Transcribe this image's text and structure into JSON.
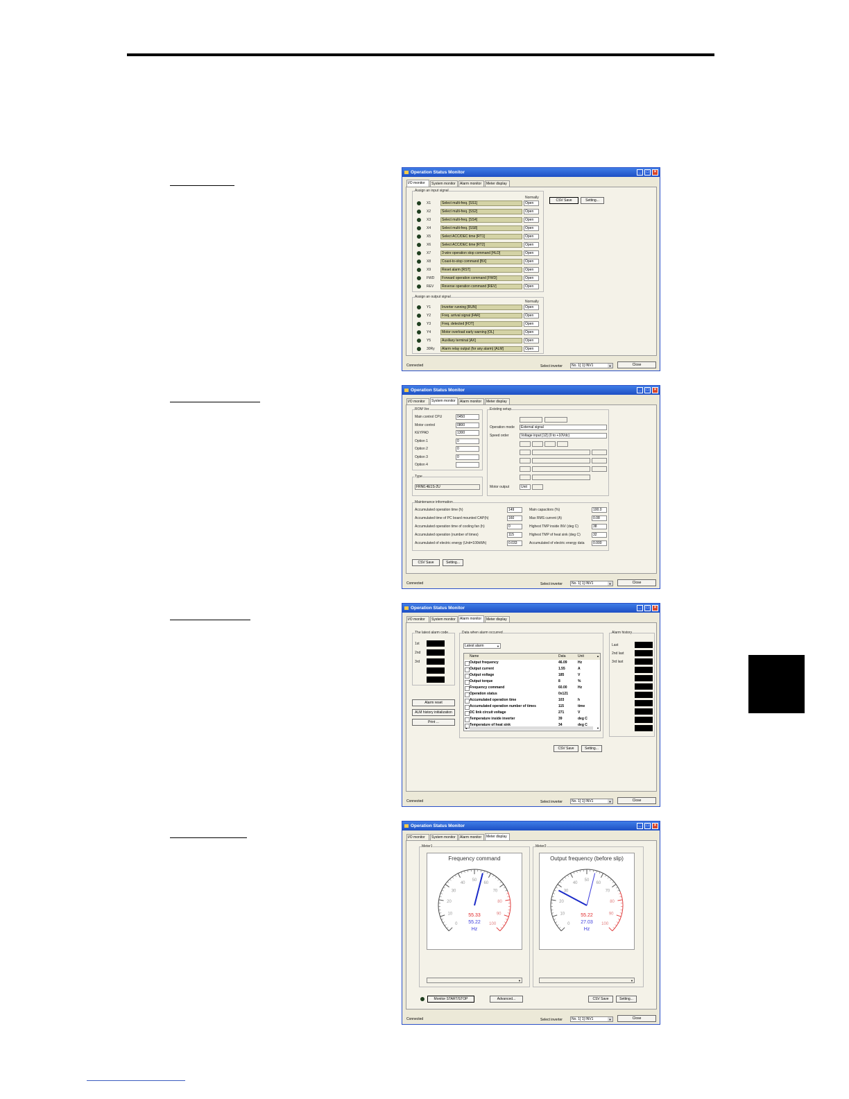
{
  "app": {
    "title": "Operation Status Monitor",
    "tabs": [
      "I/O monitor",
      "System monitor",
      "Alarm monitor",
      "Meter display"
    ],
    "status": "Connected",
    "select_inverter_label": "Select inverter",
    "inverter_value": "No. 1[ 1] INV1",
    "close_label": "Close",
    "csv_save_label": "CSV Save",
    "setting_label": "Setting..."
  },
  "io": {
    "input_group": "Assign an input signal",
    "output_group": "Assign an output signal",
    "normally_header": "Normally",
    "normally_value": "Open",
    "inputs": [
      {
        "term": "X1",
        "signal": "Select multi-freq. [SS1]"
      },
      {
        "term": "X2",
        "signal": "Select multi-freq. [SS2]"
      },
      {
        "term": "X3",
        "signal": "Select multi-freq. [SS4]"
      },
      {
        "term": "X4",
        "signal": "Select multi-freq. [SS8]"
      },
      {
        "term": "X5",
        "signal": "Select ACC/DEC time [RT1]"
      },
      {
        "term": "X6",
        "signal": "Select ACC/DEC time [RT2]"
      },
      {
        "term": "X7",
        "signal": "3-wire operation stop command [HLD]"
      },
      {
        "term": "X8",
        "signal": "Coast-to-stop command [BX]"
      },
      {
        "term": "X9",
        "signal": "Reset alarm [RST]"
      },
      {
        "term": "FWD",
        "signal": "Forward operation command [FWD]"
      },
      {
        "term": "REV",
        "signal": "Reverse operation command [REV]"
      }
    ],
    "outputs": [
      {
        "term": "Y1",
        "signal": "Inverter running [RUN]"
      },
      {
        "term": "Y2",
        "signal": "Freq. arrival signal [FAR]"
      },
      {
        "term": "Y3",
        "signal": "Freq. detected [FDT]"
      },
      {
        "term": "Y4",
        "signal": "Motor overload early warning [OL]"
      },
      {
        "term": "Y5",
        "signal": "Auxiliary terminal [AX]"
      },
      {
        "term": "30Ry",
        "signal": "Alarm relay output (for any alarm) [ALM]"
      }
    ]
  },
  "sys": {
    "rom_group": "ROM Ver.",
    "rom": [
      {
        "label": "Main control CPU",
        "value": "0450"
      },
      {
        "label": "Motor control",
        "value": "0800"
      },
      {
        "label": "KEYPAD",
        "value": "1300"
      },
      {
        "label": "Option 1",
        "value": "0"
      },
      {
        "label": "Option 2",
        "value": "0"
      },
      {
        "label": "Option 3",
        "value": "0"
      },
      {
        "label": "Option 4",
        "value": ""
      }
    ],
    "type_group": "Type",
    "type_value": "FRN0.4E1S-2U",
    "exist_group": "Existing setup",
    "op_mode_label": "Operation mode",
    "op_mode_value": "External signal",
    "speed_order_label": "Speed order",
    "speed_order_value": "Voltage input [12] (0 to +10Vdc)",
    "motor_output_label": "Motor output",
    "motor_output_value": "Unit",
    "maint_group": "Maintenance information",
    "maint_left": [
      {
        "label": "Accumulated operation time (h)",
        "value": "149"
      },
      {
        "label": "Accumulated time of PC board mounted CAP(h)",
        "value": "160"
      },
      {
        "label": "Accumulated operation time of cooling fan (h)",
        "value": "0"
      },
      {
        "label": "Accumulated operation (number of times)",
        "value": "115"
      },
      {
        "label": "Accumulated of electric energy (Unit=100kWh)",
        "value": "0.033"
      }
    ],
    "maint_right": [
      {
        "label": "Main capacitors (%)",
        "value": "100.0"
      },
      {
        "label": "Max RMS current (A)",
        "value": "0.08"
      },
      {
        "label": "Highest TMP inside INV (deg C)",
        "value": "38"
      },
      {
        "label": "Highest TMP of heat sink (deg C)",
        "value": "32"
      },
      {
        "label": "Accumulated of electric energy data",
        "value": "0.000"
      }
    ]
  },
  "alarm": {
    "latest_group": "The latest alarm code",
    "latest": [
      "1st",
      "2nd",
      "3rd",
      "",
      ""
    ],
    "data_group": "Data when alarm occurred",
    "dropdown": "Latest alarm",
    "headers": [
      "Name",
      "Data",
      "Unit"
    ],
    "rows": [
      {
        "name": "Output frequency",
        "data": "46.09",
        "unit": "Hz"
      },
      {
        "name": "Output current",
        "data": "1.55",
        "unit": "A"
      },
      {
        "name": "Output voltage",
        "data": "185",
        "unit": "V"
      },
      {
        "name": "Output torque",
        "data": "8",
        "unit": "%"
      },
      {
        "name": "Frequency command",
        "data": "60.00",
        "unit": "Hz"
      },
      {
        "name": "Operation status",
        "data": "0x121",
        "unit": ""
      },
      {
        "name": "Accumulated operation time",
        "data": "103",
        "unit": "h"
      },
      {
        "name": "Accumulated operation number of times",
        "data": "115",
        "unit": "time"
      },
      {
        "name": "DC link circuit voltage",
        "data": "271",
        "unit": "V"
      },
      {
        "name": "Temperature inside inverter",
        "data": "39",
        "unit": "deg C"
      },
      {
        "name": "Temperature of heat sink",
        "data": "34",
        "unit": "deg C"
      }
    ],
    "alarm_reset": "Alarm reset",
    "history_init": "ALM history initialization",
    "print": "Print ...",
    "history_group": "Alarm history",
    "history": [
      "Last",
      "2nd last",
      "3rd last"
    ]
  },
  "meter": {
    "meter1_group": "Meter1",
    "meter2_group": "Meter2",
    "m1_title": "Frequency command",
    "m2_title": "Output frequency (before slip)",
    "m1_v1": "55.33",
    "m1_v2": "55.22",
    "m1_unit": "Hz",
    "m2_v1": "55.22",
    "m2_v2": "27.03",
    "m2_unit": "Hz",
    "m1_needle": 55.33,
    "m2_needle_a": 55.22,
    "m2_needle_b": 27.03,
    "m1_ticks": [
      "0",
      "10",
      "20",
      "30",
      "40",
      "50",
      "60",
      "70",
      "80",
      "90",
      "100"
    ],
    "m2_ticks": [
      "0",
      "10",
      "20",
      "30",
      "40",
      "50",
      "60",
      "70",
      "80",
      "90",
      "100"
    ],
    "monitor_btn": "Monitor START/STOP",
    "advanced_btn": "Advanced..."
  }
}
